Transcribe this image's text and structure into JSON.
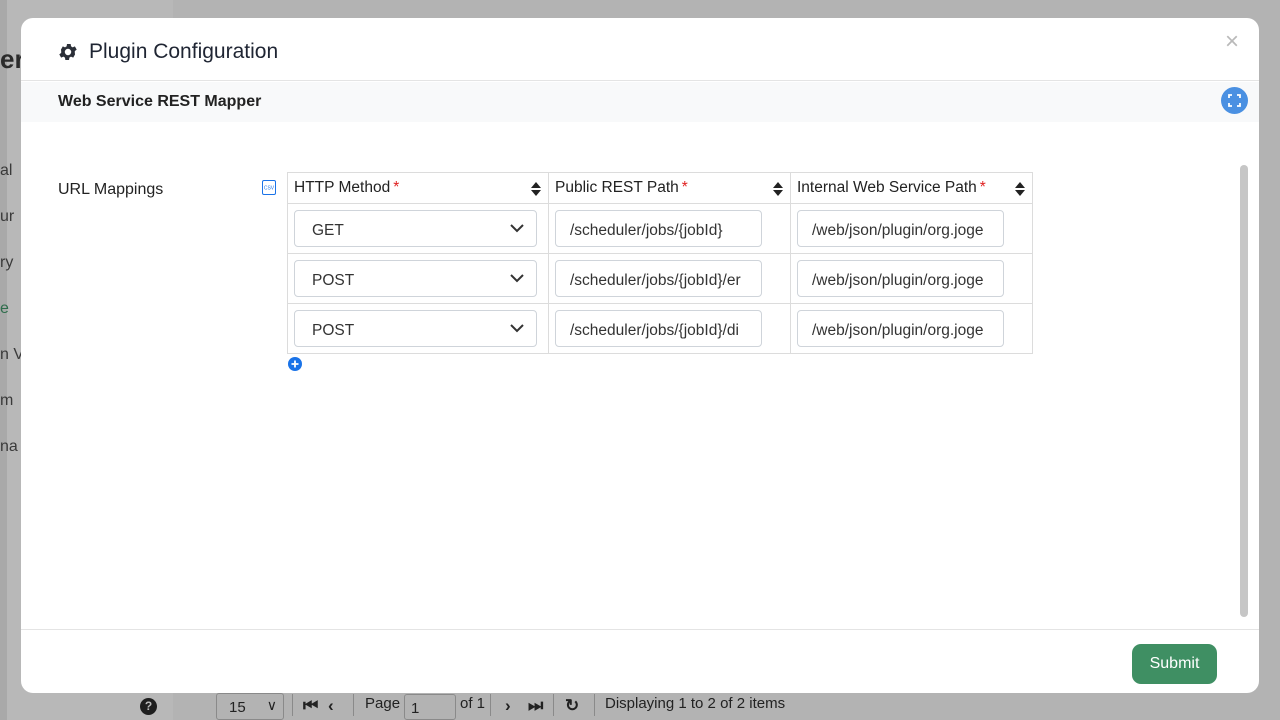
{
  "background": {
    "title_fragment": "er",
    "nav_fragments": [
      "al",
      "ur",
      "ry",
      "e",
      "n V",
      "m",
      "na"
    ],
    "pager": {
      "page_size": "15",
      "page_label": "Page",
      "page_value": "1",
      "of_label": "of 1",
      "display_text": "Displaying 1 to 2 of 2 items",
      "help_glyph": "?"
    }
  },
  "modal": {
    "title": "Plugin Configuration",
    "title_icon": "gear-icon",
    "close_glyph": "×",
    "plugin_name": "Web Service REST Mapper",
    "field": {
      "label": "URL Mappings",
      "columns": [
        {
          "label": "HTTP Method",
          "required": "*"
        },
        {
          "label": "Public REST Path",
          "required": "*"
        },
        {
          "label": "Internal Web Service Path",
          "required": "*"
        }
      ],
      "rows": [
        {
          "method": "GET",
          "public_path": "/scheduler/jobs/{jobId}",
          "internal_path": "/web/json/plugin/org.joge"
        },
        {
          "method": "POST",
          "public_path": "/scheduler/jobs/{jobId}/er",
          "internal_path": "/web/json/plugin/org.joge"
        },
        {
          "method": "POST",
          "public_path": "/scheduler/jobs/{jobId}/di",
          "internal_path": "/web/json/plugin/org.joge"
        }
      ]
    },
    "submit_label": "Submit"
  },
  "colors": {
    "accent_blue": "#4a90e2",
    "add_blue": "#1a73e8",
    "submit_green": "#3f8f63",
    "required_red": "#e02020"
  }
}
